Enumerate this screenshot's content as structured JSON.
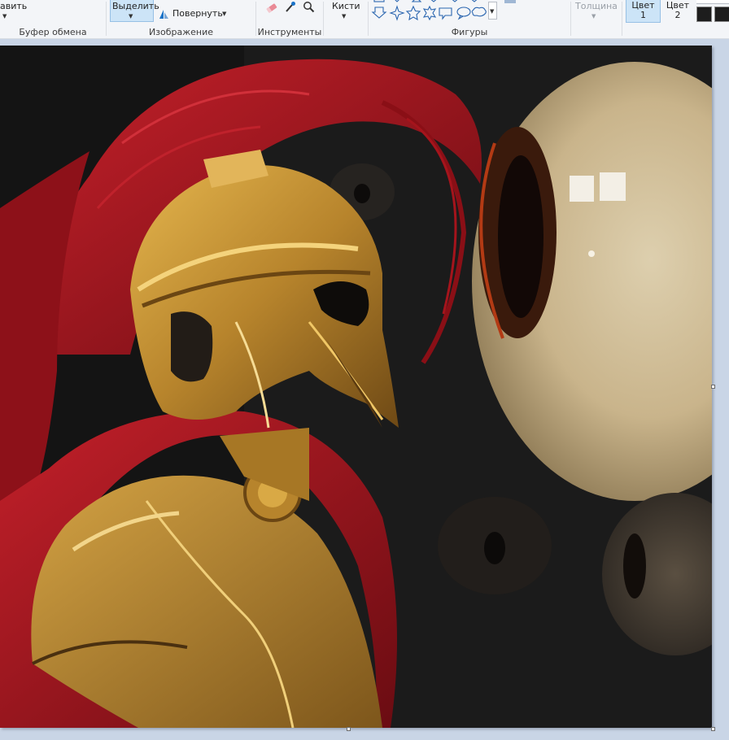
{
  "ribbon": {
    "clipboard": {
      "paste_label": "авить",
      "group_label": "Буфер обмена"
    },
    "image": {
      "select_label": "Выделить",
      "rotate_label": "Повернуть",
      "group_label": "Изображение"
    },
    "tools": {
      "group_label": "Инструменты",
      "icons": [
        "eraser-icon",
        "color-picker-icon",
        "magnifier-icon"
      ]
    },
    "brushes": {
      "label": "Кисти"
    },
    "shapes": {
      "group_label": "Фигуры",
      "icons": [
        "rectangle-shape-icon",
        "diamond-shape-icon",
        "triangle-shape-icon",
        "arrow-down-shape-icon",
        "four-point-star-icon",
        "five-point-star-icon",
        "six-point-star-icon",
        "rect-callout-icon",
        "oval-callout-icon",
        "cloud-callout-icon"
      ]
    },
    "size": {
      "label": "Толщина"
    },
    "colors": {
      "color1_label": "Цвет 1",
      "color2_label": "Цвет 2",
      "color1_line1": "Цвет",
      "color1_line2": "1",
      "color2_line1": "Цвет",
      "color2_line2": "2",
      "swatch_color": "#1d1d1d"
    }
  },
  "canvas": {
    "description_colors": {
      "background": "#111111",
      "plume": "#a5141c",
      "helmet": "#b8862e",
      "orb": "#cdbb95"
    }
  }
}
